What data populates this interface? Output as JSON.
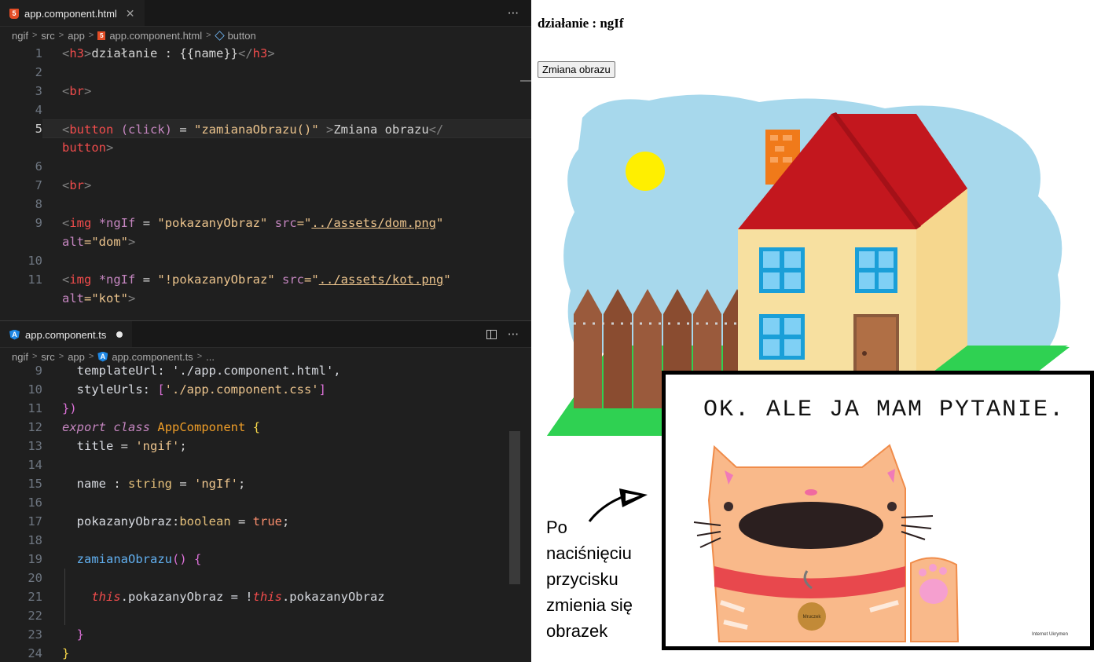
{
  "editor": {
    "top_tab": {
      "filename": "app.component.html",
      "icon": "html5-icon"
    },
    "top_breadcrumb": [
      "ngif",
      "src",
      "app",
      "app.component.html",
      "button"
    ],
    "html_lines": [
      {
        "num": "1"
      },
      {
        "num": "2"
      },
      {
        "num": "3"
      },
      {
        "num": "4"
      },
      {
        "num": "5"
      },
      {
        "num": "6"
      },
      {
        "num": "7"
      },
      {
        "num": "8"
      },
      {
        "num": "9"
      },
      {
        "num": "10"
      },
      {
        "num": "11"
      }
    ],
    "html_code": {
      "l1_open": "h3",
      "l1_text": "działanie : {{name}}",
      "l1_close": "h3",
      "l3_tag": "br",
      "l5_tag": "button",
      "l5_attr": "(click)",
      "l5_eq": " = ",
      "l5_val": "\"zamianaObrazu()\"",
      "l5_text": "Zmiana obrazu",
      "l5_close_start": "</",
      "l5b_close": "button",
      "l7_tag": "br",
      "l9_tag": "img",
      "l9_attr": "*ngIf",
      "l9_eq": " = ",
      "l9_val": "\"pokazanyObraz\"",
      "l9_src": "src",
      "l9_src_q1": "=\"",
      "l9_src_val": "../assets/dom.png",
      "l9_src_q2": "\"",
      "l9b_alt": "alt",
      "l9b_val": "=\"dom\"",
      "l11_tag": "img",
      "l11_attr": "*ngIf",
      "l11_eq": " = ",
      "l11_val": "\"!pokazanyObraz\"",
      "l11_src": "src",
      "l11_src_q1": "=\"",
      "l11_src_val": "../assets/kot.png",
      "l11_src_q2": "\"",
      "l11b_alt": "alt",
      "l11b_val": "=\"kot\""
    },
    "bottom_tab": {
      "filename": "app.component.ts",
      "icon": "angular-icon"
    },
    "bottom_breadcrumb": [
      "ngif",
      "src",
      "app",
      "app.component.ts",
      "..."
    ],
    "ts_lines": [
      "9",
      "10",
      "11",
      "12",
      "13",
      "14",
      "15",
      "16",
      "17",
      "18",
      "19",
      "20",
      "21",
      "22",
      "23",
      "24"
    ],
    "ts_code": {
      "l9": "templateUrl: './app.component.html',",
      "l10_key": "styleUrls: ",
      "l10_val": "'./app.component.css'",
      "l11": "})",
      "l12_export": "export",
      "l12_class": "class",
      "l12_name": "AppComponent",
      "l12_brace": "{",
      "l13_key": "title",
      "l13_eq": " = ",
      "l13_val": "'ngif'",
      "l13_end": ";",
      "l15_key": "name",
      "l15_colon": " : ",
      "l15_type": "string",
      "l15_eq": " = ",
      "l15_val": "'ngIf'",
      "l15_end": ";",
      "l17_key": "pokazanyObraz",
      "l17_colon": ":",
      "l17_type": "boolean",
      "l17_eq": " = ",
      "l17_val": "true",
      "l17_end": ";",
      "l19_fn": "zamianaObrazu",
      "l19_paren": "()",
      "l19_brace": "{",
      "l21_this1": "this",
      "l21_prop1": ".pokazanyObraz = !",
      "l21_this2": "this",
      "l21_prop2": ".pokazanyObraz",
      "l23": "}",
      "l24": "}"
    }
  },
  "preview": {
    "heading": "działanie : ngIf",
    "button_label": "Zmiana obrazu",
    "house_image": {
      "alt": "dom"
    },
    "cat_image": {
      "alt": "kot",
      "caption_text": "OK. ALE JA MAM PYTANIE.",
      "tag_text": "Mruczek",
      "signature": "Internet Ukrymen"
    },
    "annotation": "Po naciśnięciu przycisku zmienia się obrazek"
  },
  "colors": {
    "editor_bg": "#1f1f1f",
    "sky": "#a7d8ec",
    "roof": "#c3171e",
    "wall": "#f7e0a0",
    "grass": "#2fd152",
    "fence": "#9a5a3c",
    "window": "#1a9fd8",
    "door": "#b06f45",
    "sun": "#ffef00",
    "cat_fur": "#f9b98a",
    "collar": "#e8484d"
  }
}
